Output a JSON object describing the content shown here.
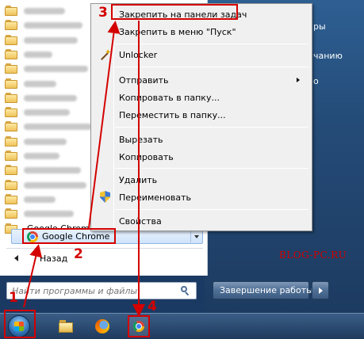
{
  "start_menu": {
    "all_programs_items": [
      {
        "label": ""
      },
      {
        "label": ""
      },
      {
        "label": ""
      },
      {
        "label": ""
      },
      {
        "label": ""
      },
      {
        "label": ""
      },
      {
        "label": ""
      },
      {
        "label": ""
      },
      {
        "label": ""
      },
      {
        "label": ""
      },
      {
        "label": ""
      },
      {
        "label": ""
      },
      {
        "label": ""
      },
      {
        "label": ""
      },
      {
        "label": ""
      },
      {
        "label": "Google Chrom"
      }
    ],
    "highlighted_item": "Google Chrome",
    "back_label": "Назад",
    "search_placeholder": "Найти программы и файлы",
    "shutdown_label": "Завершение работы",
    "right_pane_fragments": [
      "ры",
      "чанию",
      "о"
    ]
  },
  "context_menu": {
    "items": [
      {
        "label": "Закрепить на панели задач",
        "icon": null,
        "submenu": false
      },
      {
        "label": "Закрепить в меню \"Пуск\"",
        "icon": null,
        "submenu": false
      },
      {
        "label": "Unlocker",
        "icon": "unlocker-wand-icon",
        "submenu": false
      },
      {
        "label": "Отправить",
        "icon": null,
        "submenu": true
      },
      {
        "label": "Копировать в папку...",
        "icon": null,
        "submenu": false
      },
      {
        "label": "Переместить в папку...",
        "icon": null,
        "submenu": false
      },
      {
        "label": "Вырезать",
        "icon": null,
        "submenu": false
      },
      {
        "label": "Копировать",
        "icon": null,
        "submenu": false
      },
      {
        "label": "Удалить",
        "icon": null,
        "submenu": false
      },
      {
        "label": "Переименовать",
        "icon": "uac-shield-icon",
        "submenu": false
      },
      {
        "label": "Свойства",
        "icon": null,
        "submenu": false
      }
    ]
  },
  "annotations": {
    "steps": [
      "1",
      "2",
      "3",
      "4"
    ],
    "watermark": "BLOG-PC.RU",
    "color": "#d40000"
  },
  "taskbar": {
    "icons": [
      "start-orb-icon",
      "explorer-folder-icon",
      "firefox-icon",
      "chrome-icon"
    ]
  }
}
